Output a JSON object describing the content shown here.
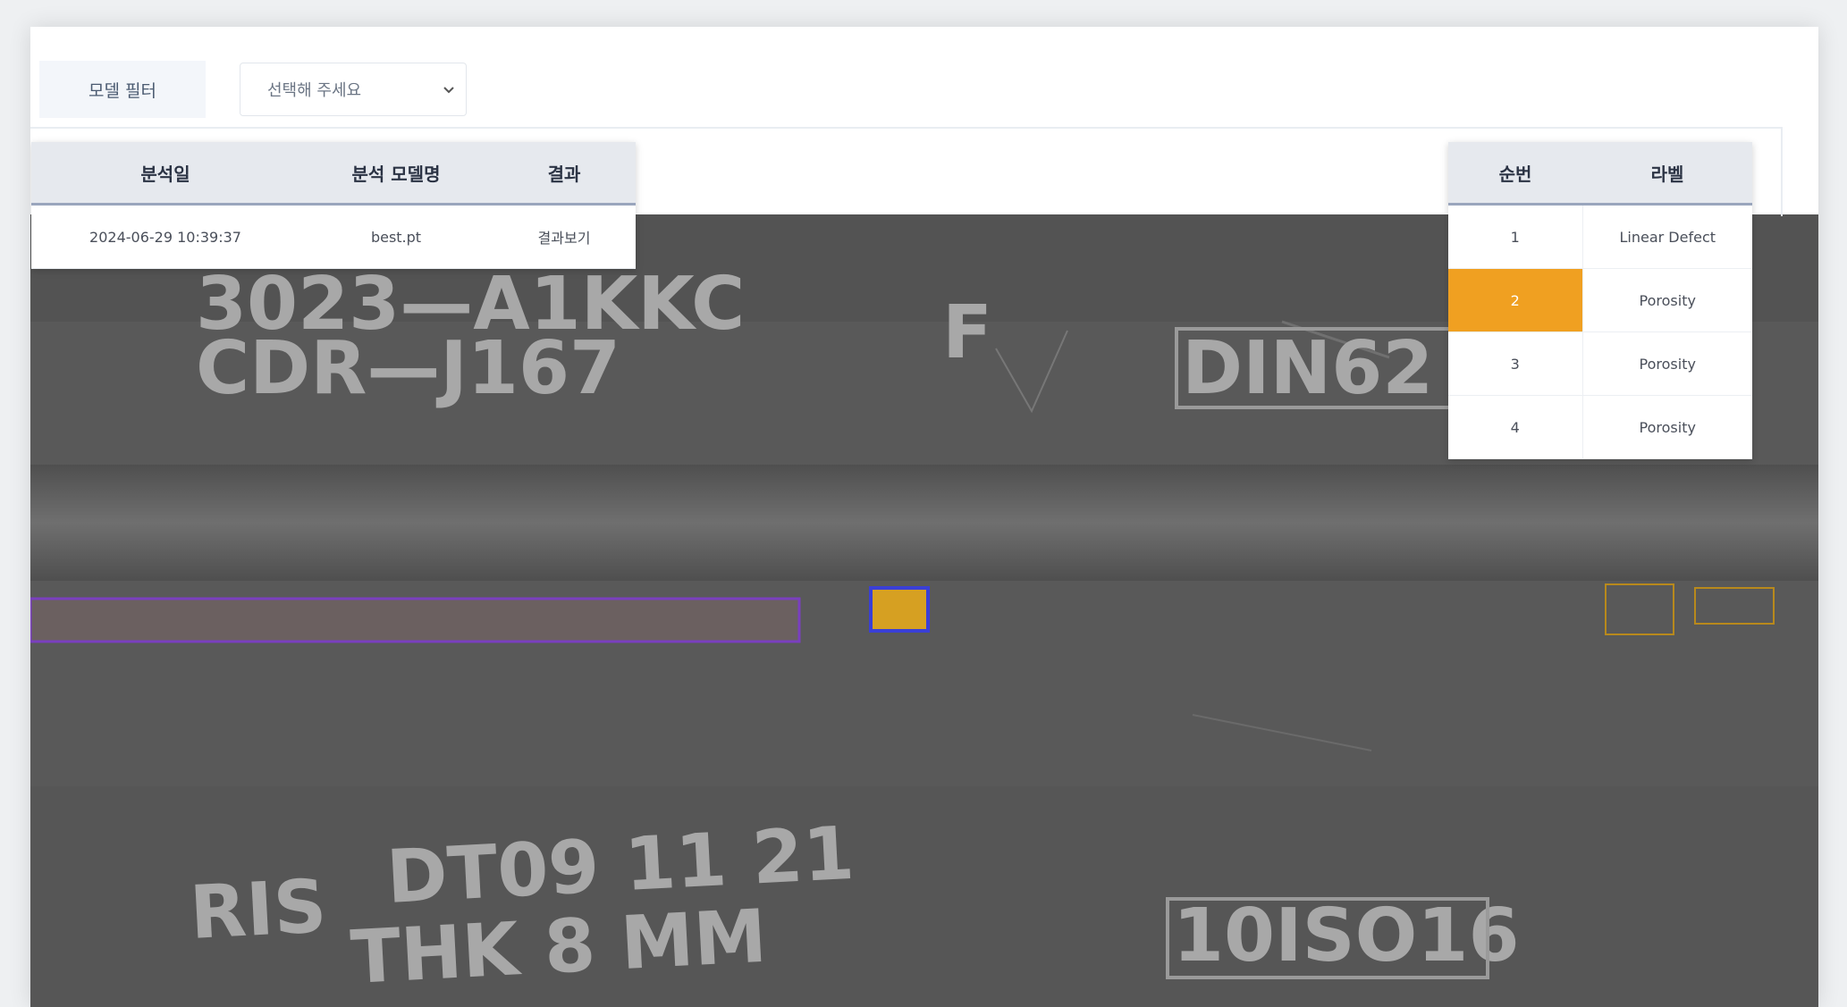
{
  "toolbar": {
    "model_label": "모델 필터",
    "model_select_placeholder": "선택해 주세요"
  },
  "analysis_table": {
    "headers": [
      "분석일",
      "분석 모델명",
      "결과"
    ],
    "rows": [
      {
        "date": "2024-06-29 10:39:37",
        "model": "best.pt",
        "result": "결과보기"
      }
    ]
  },
  "label_table": {
    "headers": [
      "순번",
      "라벨"
    ],
    "rows": [
      {
        "num": "1",
        "label": "Linear Defect"
      },
      {
        "num": "2",
        "label": "Porosity"
      },
      {
        "num": "3",
        "label": "Porosity"
      },
      {
        "num": "4",
        "label": "Porosity"
      }
    ],
    "selected_row": "2"
  },
  "xray_markings": {
    "top_left_line1": "3023—A1KKC",
    "top_left_line2": "CDR—J167",
    "top_center": "F",
    "top_right": "DIN62",
    "bottom_left_1": "RIS",
    "bottom_left_2": "DT09 11 21",
    "bottom_left_3": "THK 8 MM",
    "bottom_right": "10ISO16"
  },
  "colors": {
    "accent_orange": "#f0a021",
    "linear_defect_box": "#7a3fbf",
    "selected_porosity_box": "#3a3fd6",
    "porosity_box": "#b8891c"
  },
  "icons": {
    "select_arrow": "chevron-down-icon"
  }
}
